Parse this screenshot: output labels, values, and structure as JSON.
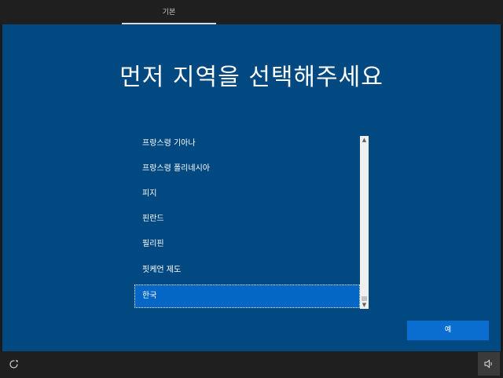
{
  "header": {
    "tab_label": "기본"
  },
  "main": {
    "title": "먼저 지역을 선택해주세요"
  },
  "region_list": {
    "items": [
      {
        "label": "프랑스령 기아나"
      },
      {
        "label": "프랑스령 폴리네시아"
      },
      {
        "label": "피지"
      },
      {
        "label": "핀란드"
      },
      {
        "label": "필리핀"
      },
      {
        "label": "핏케언 제도"
      },
      {
        "label": "한국"
      }
    ],
    "selected_index": 6
  },
  "actions": {
    "confirm_label": "예"
  },
  "colors": {
    "panel_bg": "#024881",
    "selection": "#0467c5",
    "button": "#0a6ed0"
  },
  "icons": {
    "ease_of_access": "ease-of-access-icon",
    "volume": "volume-icon"
  }
}
